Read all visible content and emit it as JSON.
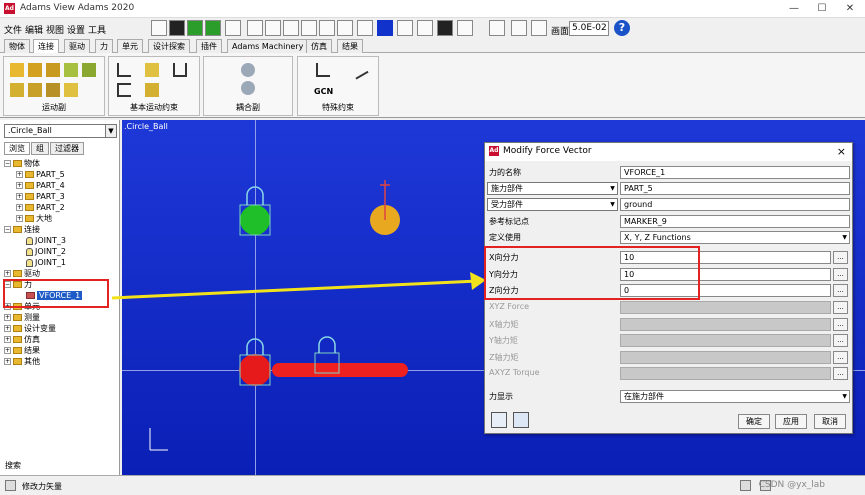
{
  "window": {
    "title": "Adams View Adams 2020",
    "app_icon": "Ad"
  },
  "menubar": {
    "items": [
      "文件",
      "编辑",
      "视图",
      "设置",
      "工具"
    ]
  },
  "toolbar": {
    "zoom_label": "画面",
    "zoom_value": "5.0E-02",
    "help": "?"
  },
  "ribbon": {
    "tabs": [
      "物体",
      "连接",
      "驱动",
      "力",
      "单元",
      "设计探索",
      "插件",
      "Adams Machinery",
      "仿真",
      "结果"
    ],
    "active_tab": "连接",
    "groups": [
      {
        "label": "运动副"
      },
      {
        "label": "基本运动约束"
      },
      {
        "label": "耦合副"
      },
      {
        "label": "特殊约束",
        "gcn": "GCN"
      }
    ]
  },
  "browser": {
    "model_selector": ".Circle_Ball",
    "tabs": [
      "浏览",
      "组",
      "过滤器"
    ],
    "tree": [
      {
        "label": "物体",
        "type": "folder",
        "expanded": true
      },
      {
        "label": "PART_5",
        "type": "part"
      },
      {
        "label": "PART_4",
        "type": "part"
      },
      {
        "label": "PART_3",
        "type": "part"
      },
      {
        "label": "PART_2",
        "type": "part"
      },
      {
        "label": "大地",
        "type": "part"
      },
      {
        "label": "连接",
        "type": "folder",
        "expanded": true
      },
      {
        "label": "JOINT_3",
        "type": "joint"
      },
      {
        "label": "JOINT_2",
        "type": "joint"
      },
      {
        "label": "JOINT_1",
        "type": "joint"
      },
      {
        "label": "驱动",
        "type": "folder"
      },
      {
        "label": "力",
        "type": "folder",
        "expanded": true
      },
      {
        "label": "VFORCE_1",
        "type": "force",
        "selected": true
      },
      {
        "label": "单元",
        "type": "folder"
      },
      {
        "label": "测量",
        "type": "folder"
      },
      {
        "label": "设计变量",
        "type": "folder"
      },
      {
        "label": "仿真",
        "type": "folder"
      },
      {
        "label": "结果",
        "type": "folder"
      },
      {
        "label": "其他",
        "type": "folder"
      }
    ],
    "search_label": "搜索"
  },
  "viewport": {
    "title": ".Circle_Ball"
  },
  "dialog": {
    "title": "Modify Force Vector",
    "close": "×",
    "rows": {
      "name_label": "力的名称",
      "name_value": "VFORCE_1",
      "action_part_select": "施力部件",
      "action_part_value": "PART_5",
      "reaction_part_select": "受力部件",
      "reaction_part_value": "ground",
      "ref_marker_label": "参考标记点",
      "ref_marker_value": "MARKER_9",
      "define_label": "定义使用",
      "define_value": "X, Y, Z Functions",
      "x_label": "X向分力",
      "x_value": "10",
      "y_label": "Y向分力",
      "y_value": "10",
      "z_label": "Z向分力",
      "z_value": "0",
      "xyz_force_label": "XYZ Force",
      "x_torque_label": "X轴力矩",
      "y_torque_label": "Y轴力矩",
      "z_torque_label": "Z轴力矩",
      "xyz_torque_label": "AXYZ Torque",
      "display_label": "力显示",
      "display_value": "在施力部件"
    },
    "buttons": {
      "ok": "确定",
      "apply": "应用",
      "cancel": "取消"
    }
  },
  "statusbar": {
    "text": "修改力矢量",
    "watermark": "CSDN @yx_lab"
  },
  "colors": {
    "annotation_red": "#e42222",
    "arrow_yellow": "#f2e21b",
    "viewport_blue": "#1530c8"
  }
}
